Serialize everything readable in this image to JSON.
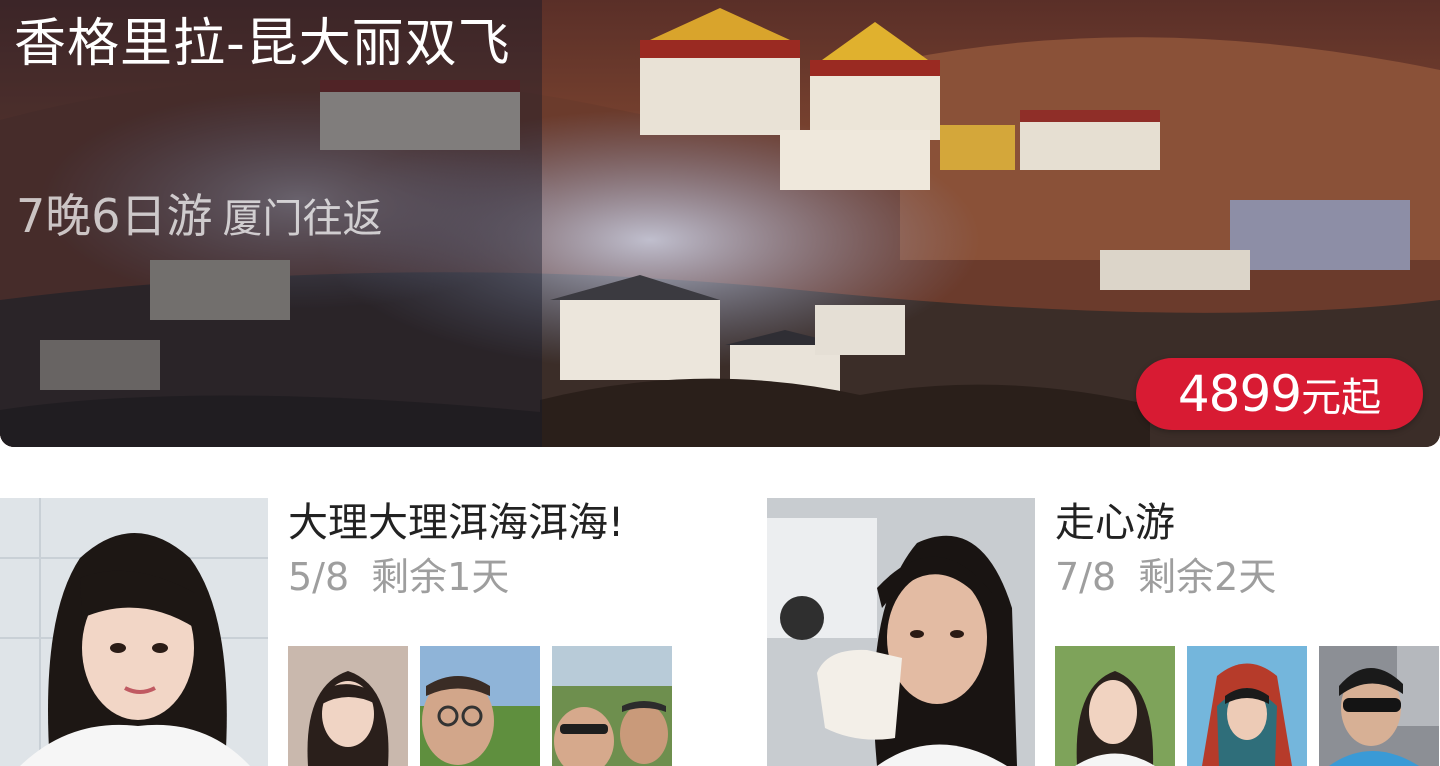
{
  "hero": {
    "title": "香格里拉-昆大丽双飞",
    "duration": "7晚6日游",
    "route": "厦门往返",
    "price_amount": "4899",
    "price_unit": "元起",
    "badge_color": "#d81b33"
  },
  "cards": [
    {
      "title": "大理大理洱海洱海!",
      "count": "5/8",
      "remaining": "剩余1天",
      "members": 3
    },
    {
      "title": "走心游",
      "count": "7/8",
      "remaining": "剩余2天",
      "members": 3
    }
  ]
}
